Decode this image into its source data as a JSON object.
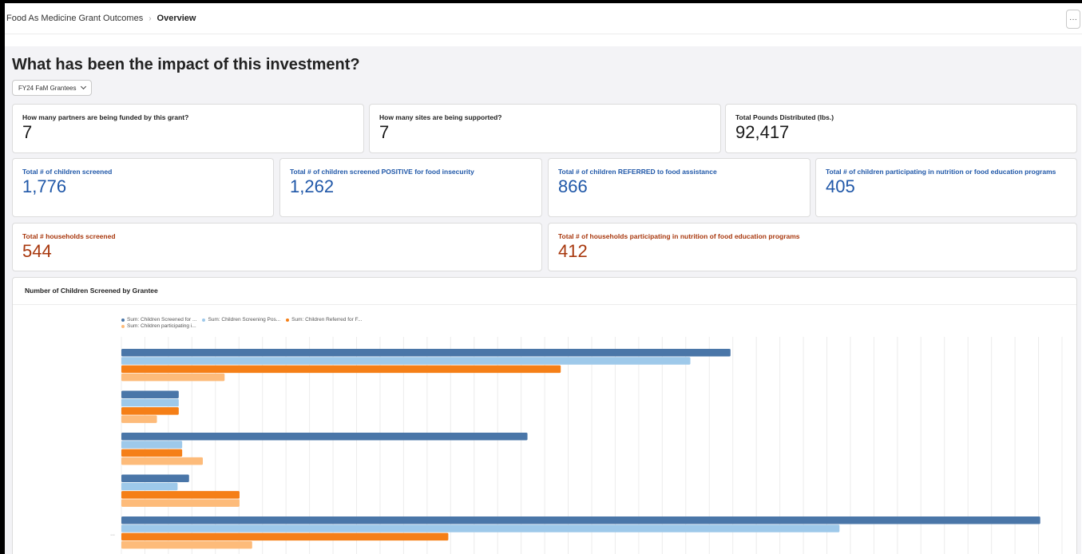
{
  "breadcrumb": {
    "root": "Food As Medicine Grant Outcomes",
    "current": "Overview"
  },
  "toolbar": {
    "more_label": "···"
  },
  "page": {
    "title": "What has been the impact of this investment?"
  },
  "filter": {
    "label": "FY24 FaM Grantees"
  },
  "kpis_row1": [
    {
      "label": "How many partners are being funded by this grant?",
      "value": "7"
    },
    {
      "label": "How many sites are being supported?",
      "value": "7"
    },
    {
      "label": "Total Pounds Distributed (lbs.)",
      "value": "92,417"
    }
  ],
  "kpis_row2": [
    {
      "label": "Total # of children screened",
      "value": "1,776"
    },
    {
      "label": "Total # of children screened POSITIVE for food insecurity",
      "value": "1,262"
    },
    {
      "label": "Total # of children REFERRED to food assistance",
      "value": "866"
    },
    {
      "label": "Total # of children participating in nutrition or food education programs",
      "value": "405"
    }
  ],
  "kpis_row3": [
    {
      "label": "Total # households screened",
      "value": "544"
    },
    {
      "label": "Total # of households participating in nutrition of food education programs",
      "value": "412"
    }
  ],
  "colors": {
    "blue_kpi": "#1f57a8",
    "rust_kpi": "#a8380e"
  },
  "chart": {
    "title": "Number of Children Screened by Grantee",
    "category_label": "...",
    "legend": [
      {
        "name": "Sum: Children Screened for ...",
        "color": "#4a76a8"
      },
      {
        "name": "Sum: Children Screening Pos...",
        "color": "#9ec9ea"
      },
      {
        "name": "Sum: Children Referred for F...",
        "color": "#f57f17"
      },
      {
        "name": "Sum: Children participating i...",
        "color": "#fdbb7a"
      }
    ]
  },
  "chart_data": {
    "type": "bar",
    "orientation": "horizontal",
    "title": "Number of Children Screened by Grantee",
    "categories": [
      "",
      "",
      "",
      "",
      "..."
    ],
    "series": [
      {
        "name": "Sum: Children Screened for ...",
        "values": [
          531,
          50,
          354,
          59,
          801
        ]
      },
      {
        "name": "Sum: Children Screening Pos...",
        "values": [
          496,
          50,
          53,
          49,
          626
        ]
      },
      {
        "name": "Sum: Children Referred for F...",
        "values": [
          383,
          50,
          53,
          103,
          285
        ]
      },
      {
        "name": "Sum: Children participating i...",
        "values": [
          90,
          31,
          71,
          103,
          114
        ]
      }
    ],
    "xlim": [
      0,
      820
    ],
    "grid": true,
    "legend_position": "top-left"
  }
}
